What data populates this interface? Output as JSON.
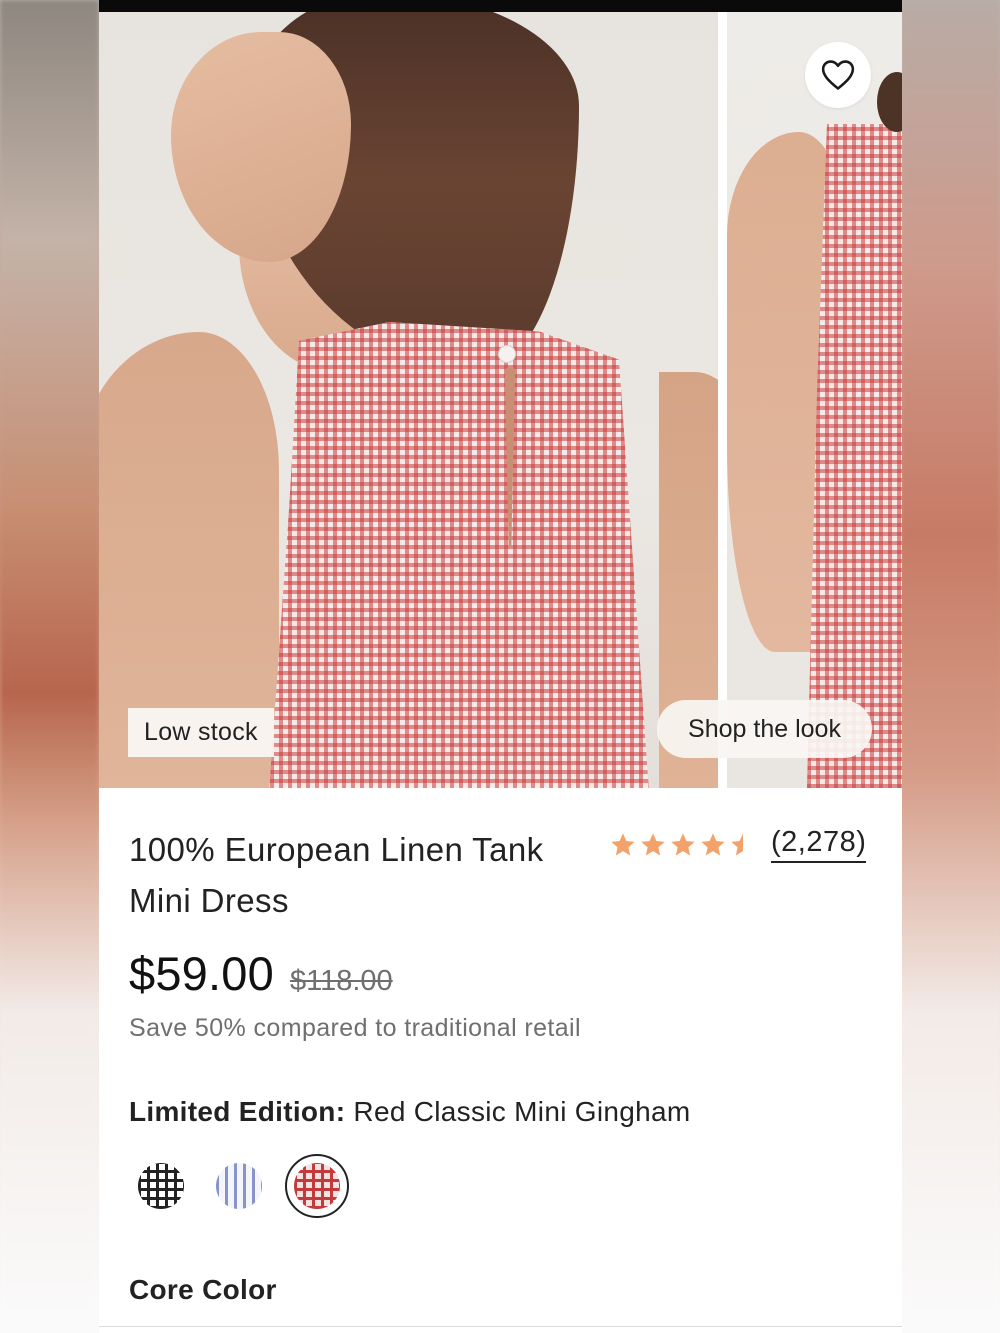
{
  "gallery": {
    "badge_low_stock": "Low stock",
    "shop_the_look": "Shop the look",
    "favorite_icon": "heart-icon"
  },
  "product": {
    "title": "100% European Linen Tank Mini Dress",
    "rating": 4.5,
    "rating_color": "#f4a26b",
    "review_count": "(2,278)",
    "price": "$59.00",
    "original_price": "$118.00",
    "savings_text": "Save 50% compared to traditional retail",
    "edition_label": "Limited Edition:",
    "edition_value": " Red Classic Mini Gingham",
    "swatches": [
      {
        "name": "black-gingham",
        "selected": false
      },
      {
        "name": "blue-stripe",
        "selected": false
      },
      {
        "name": "red-gingham",
        "selected": true
      }
    ],
    "core_color_label": "Core Color"
  }
}
